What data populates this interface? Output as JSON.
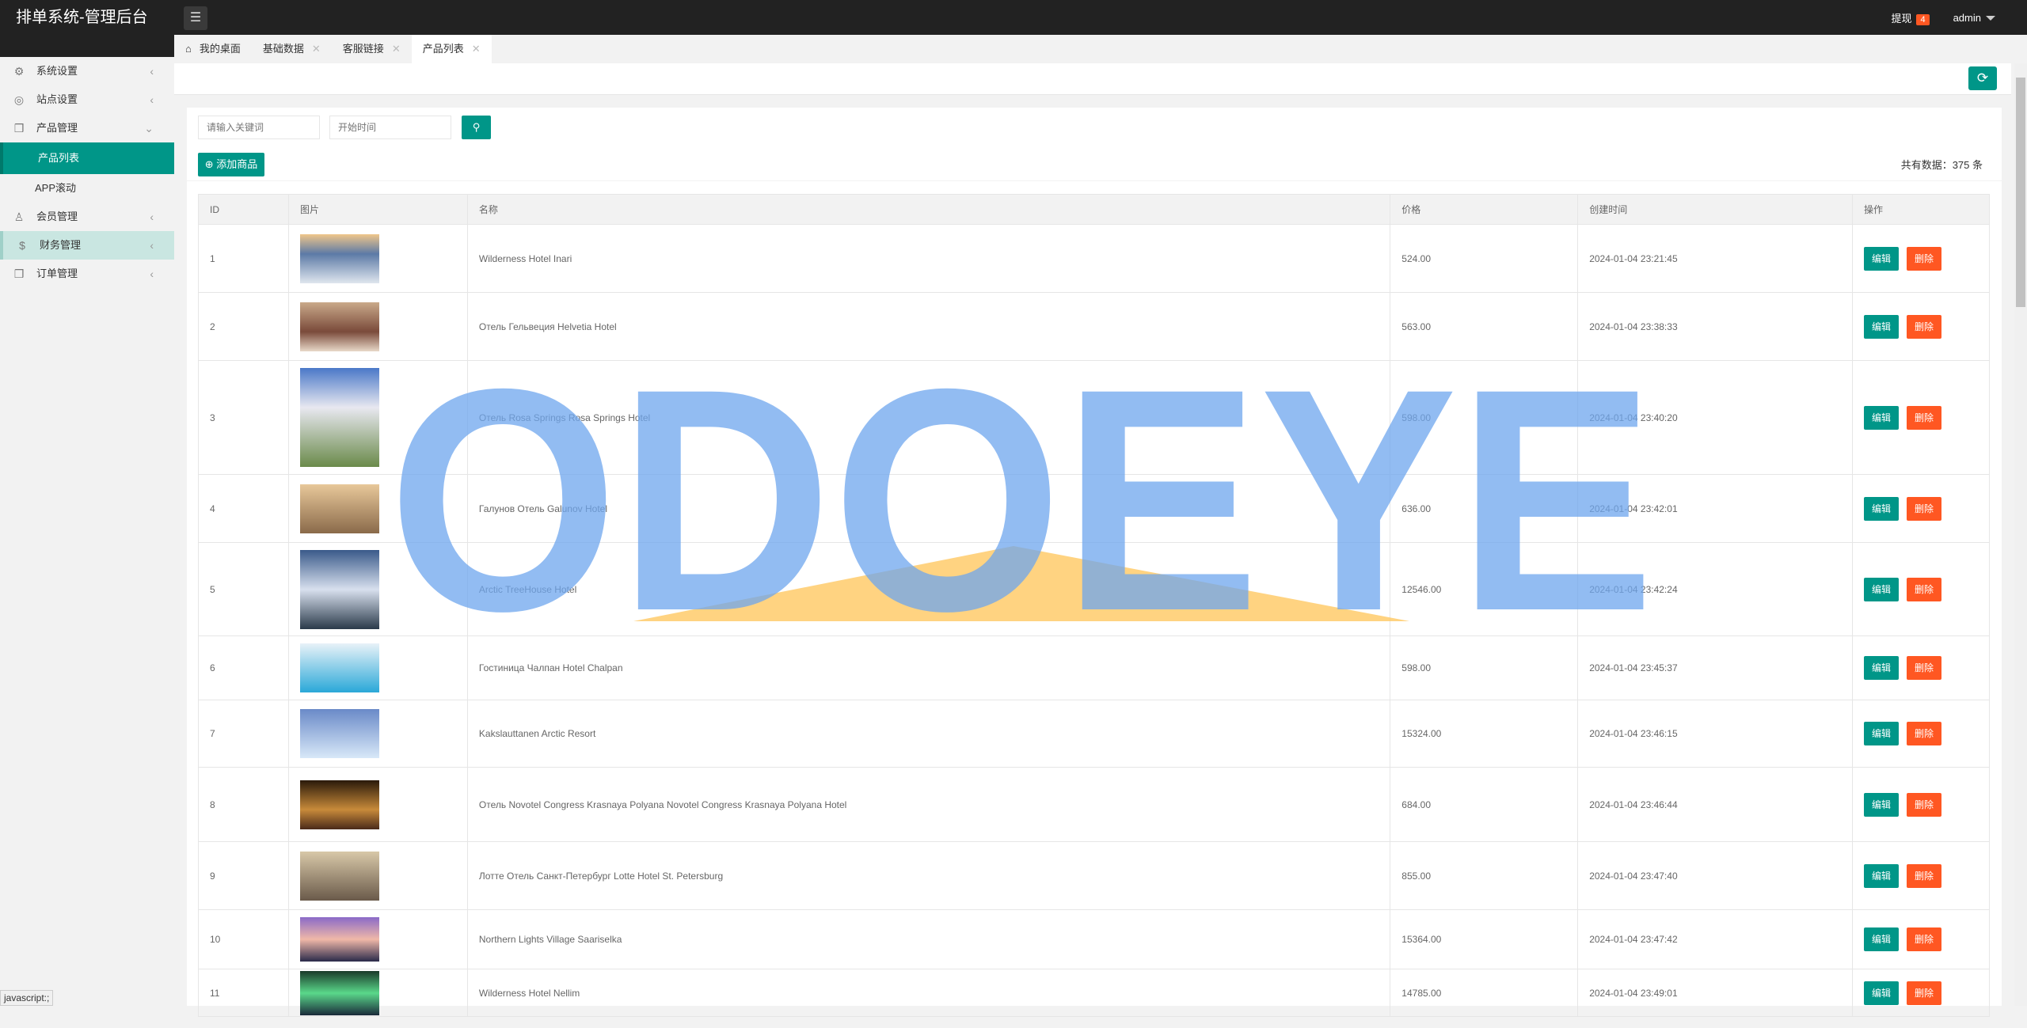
{
  "header": {
    "title": "排单系统-管理后台",
    "withdraw_label": "提现",
    "withdraw_count": "4",
    "user": "admin"
  },
  "sidebar": {
    "items": [
      {
        "label": "系统设置",
        "icon": "gear-icon",
        "arrow": "‹"
      },
      {
        "label": "站点设置",
        "icon": "site-icon",
        "arrow": "‹"
      },
      {
        "label": "产品管理",
        "icon": "box-icon",
        "arrow": "⌄"
      },
      {
        "label": "产品列表",
        "sub": true,
        "active": true
      },
      {
        "label": "APP滚动",
        "sub": true
      },
      {
        "label": "会员管理",
        "icon": "user-icon",
        "arrow": "‹"
      },
      {
        "label": "财务管理",
        "icon": "dollar-icon",
        "arrow": "‹",
        "highlighted": true
      },
      {
        "label": "订单管理",
        "icon": "box-icon",
        "arrow": "‹"
      }
    ]
  },
  "tabs": [
    {
      "label": "我的桌面",
      "home": true
    },
    {
      "label": "基础数据",
      "closable": true
    },
    {
      "label": "客服链接",
      "closable": true
    },
    {
      "label": "产品列表",
      "closable": true,
      "active": true
    }
  ],
  "filters": {
    "keyword_placeholder": "请输入关键词",
    "start_time_placeholder": "开始时间"
  },
  "actions": {
    "add_label": "添加商品",
    "total_text": "共有数据：375 条"
  },
  "table": {
    "columns": [
      "ID",
      "图片",
      "名称",
      "价格",
      "创建时间",
      "操作"
    ],
    "edit_label": "编辑",
    "delete_label": "删除",
    "rows": [
      {
        "id": "1",
        "name": "Wilderness Hotel Inari",
        "price": "524.00",
        "created": "2024-01-04 23:21:45"
      },
      {
        "id": "2",
        "name": "Отель Гельвеция Helvetia Hotel",
        "price": "563.00",
        "created": "2024-01-04 23:38:33"
      },
      {
        "id": "3",
        "name": "Отель Rosa Springs Rosa Springs Hotel",
        "price": "598.00",
        "created": "2024-01-04 23:40:20"
      },
      {
        "id": "4",
        "name": "Галунов Отель Galunov Hotel",
        "price": "636.00",
        "created": "2024-01-04 23:42:01"
      },
      {
        "id": "5",
        "name": "Arctic TreeHouse Hotel",
        "price": "12546.00",
        "created": "2024-01-04 23:42:24"
      },
      {
        "id": "6",
        "name": "Гостиница Чалпан Hotel Chalpan",
        "price": "598.00",
        "created": "2024-01-04 23:45:37"
      },
      {
        "id": "7",
        "name": "Kakslauttanen Arctic Resort",
        "price": "15324.00",
        "created": "2024-01-04 23:46:15"
      },
      {
        "id": "8",
        "name": "Отель Novotel Congress Krasnaya Polyana Novotel Congress Krasnaya Polyana Hotel",
        "price": "684.00",
        "created": "2024-01-04 23:46:44"
      },
      {
        "id": "9",
        "name": "Лотте Отель Санкт-Петербург Lotte Hotel St. Petersburg",
        "price": "855.00",
        "created": "2024-01-04 23:47:40"
      },
      {
        "id": "10",
        "name": "Northern Lights Village Saariselka",
        "price": "15364.00",
        "created": "2024-01-04 23:47:42"
      },
      {
        "id": "11",
        "name": "Wilderness Hotel Nellim",
        "price": "14785.00",
        "created": "2024-01-04 23:49:01"
      }
    ]
  },
  "watermark": {
    "text": "ODOEYE"
  },
  "statusbar": {
    "text": "javascript:;"
  },
  "colors": {
    "primary": "#009688",
    "danger": "#ff5722",
    "topbar": "#222222"
  }
}
